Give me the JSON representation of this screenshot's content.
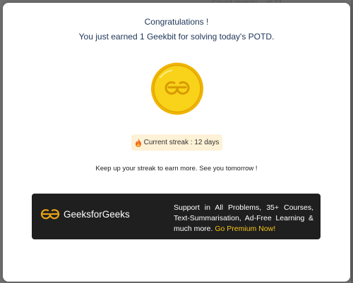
{
  "background": {
    "snippet": "Count inversi... at 11"
  },
  "modal": {
    "title": "Congratulations !",
    "subtitle": "You just earned 1 Geekbit for solving today's POTD.",
    "coin_icon": "geeksforgeeks-coin-icon",
    "streak": {
      "icon": "flame-icon",
      "text": "Current streak : 12 days"
    },
    "message": "Keep up your streak to earn more. See you tomorrow !"
  },
  "banner": {
    "logo_icon": "geeksforgeeks-logo-icon",
    "logo_text": "GeeksforGeeks",
    "promo_text": "Support in All Problems, 35+ Courses, Text-Summarisation, Ad-Free Learning & much more.",
    "promo_link": "Go Premium Now!"
  },
  "colors": {
    "overlay": "#6f6f6f",
    "modal_bg": "#ffffff",
    "title_text": "#1d3557",
    "coin_gold": "#f6c90e",
    "streak_bg": "#fdf1d6",
    "banner_bg": "#1f1f1f",
    "link_yellow": "#f5c518"
  }
}
